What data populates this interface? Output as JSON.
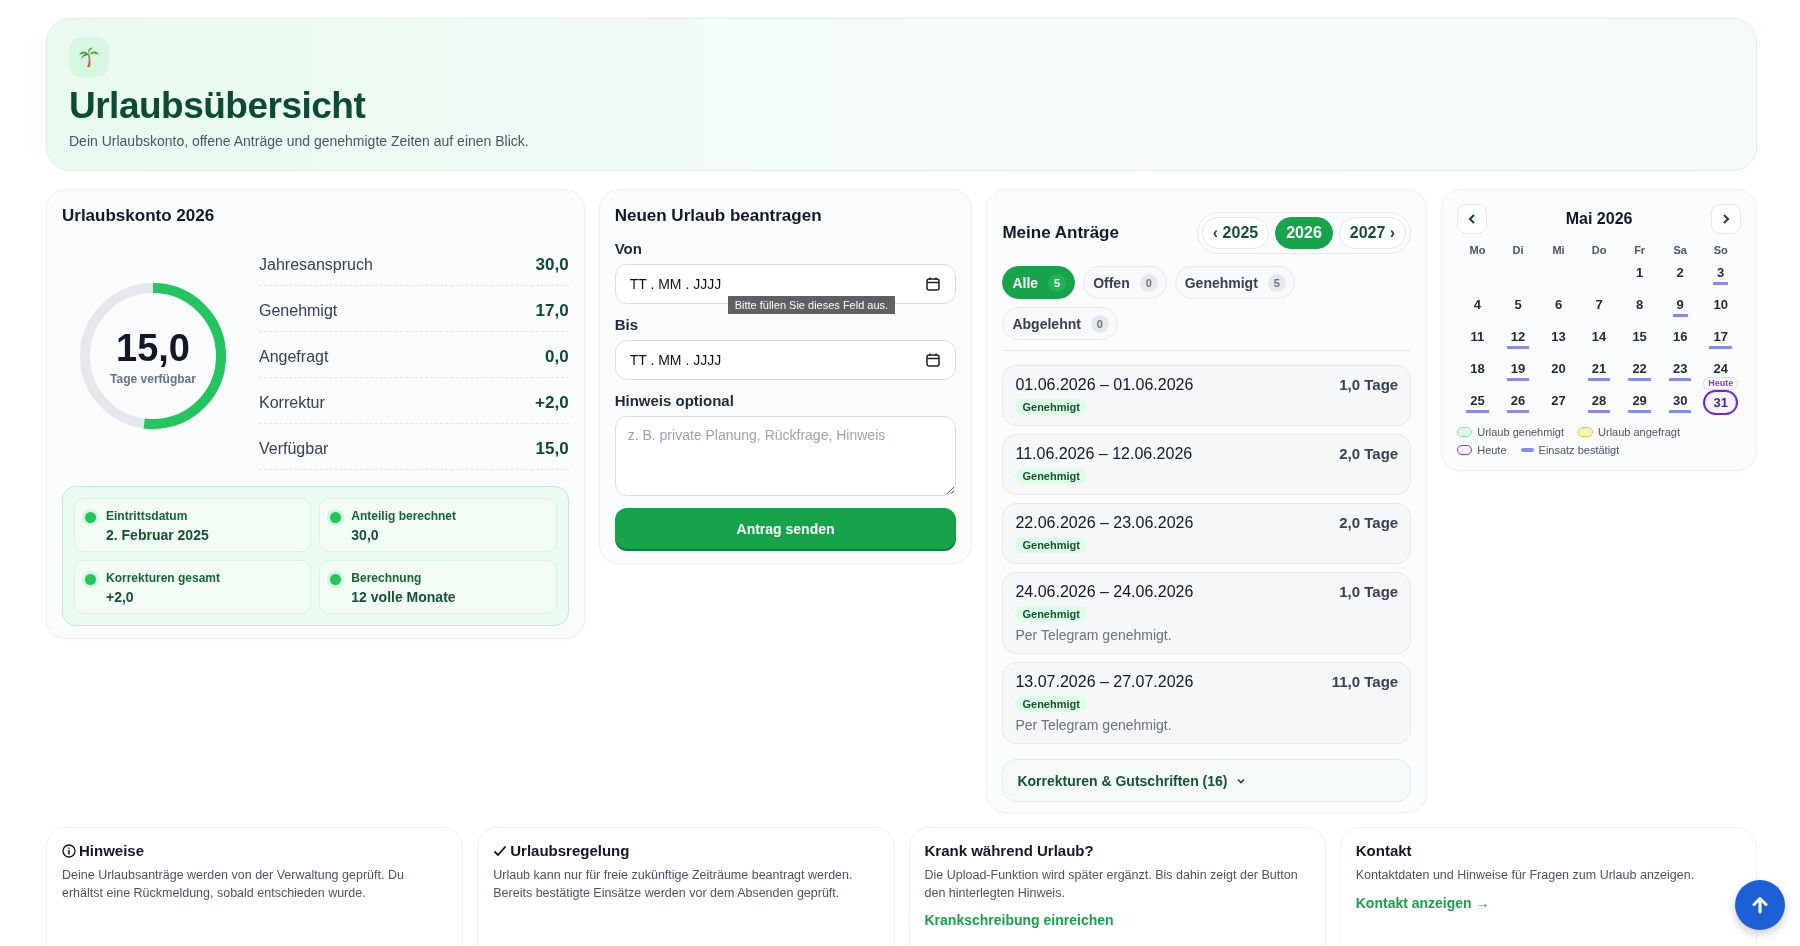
{
  "header": {
    "title": "Urlaubsübersicht",
    "subtitle": "Dein Urlaubskonto, offene Anträge und genehmigte Zeiten auf einen Blick."
  },
  "account": {
    "title": "Urlaubskonto 2026",
    "ring": {
      "value": "15,0",
      "label": "Tage verfügbar",
      "level": 0.52
    },
    "stats": [
      {
        "label": "Jahresanspruch",
        "value": "30,0"
      },
      {
        "label": "Genehmigt",
        "value": "17,0"
      },
      {
        "label": "Angefragt",
        "value": "0,0"
      },
      {
        "label": "Korrektur",
        "value": "+2,0"
      },
      {
        "label": "Verfügbar",
        "value": "15,0"
      }
    ],
    "info": [
      {
        "label": "Eintrittsdatum",
        "value": "2. Februar 2025"
      },
      {
        "label": "Anteilig berechnet",
        "value": "30,0"
      },
      {
        "label": "Korrekturen gesamt",
        "value": "+2,0"
      },
      {
        "label": "Berechnung",
        "value": "12 volle Monate"
      }
    ]
  },
  "form": {
    "title": "Neuen Urlaub beantragen",
    "from": {
      "label": "Von",
      "value": "TT . MM . JJJJ"
    },
    "tooltip": "Bitte füllen Sie dieses Feld aus.",
    "to": {
      "label": "Bis",
      "value": "TT . MM . JJJJ"
    },
    "note": {
      "label": "Hinweis optional",
      "placeholder": "z. B. private Planung, Rückfrage, Hinweis"
    },
    "submit": "Antrag senden"
  },
  "requests": {
    "title": "Meine Anträge",
    "years": [
      {
        "label": "‹ 2025",
        "selected": false
      },
      {
        "label": "2026",
        "selected": true
      },
      {
        "label": "2027 ›",
        "selected": false
      }
    ],
    "filters": [
      {
        "label": "Alle",
        "count": "5",
        "selected": true
      },
      {
        "label": "Offen",
        "count": "0",
        "selected": false
      },
      {
        "label": "Genehmigt",
        "count": "5",
        "selected": false
      },
      {
        "label": "Abgelehnt",
        "count": "0",
        "selected": false
      }
    ],
    "items": [
      {
        "range": "01.06.2026 – 01.06.2026",
        "days": "1,0 Tage",
        "status": "Genehmigt"
      },
      {
        "range": "11.06.2026 – 12.06.2026",
        "days": "2,0 Tage",
        "status": "Genehmigt"
      },
      {
        "range": "22.06.2026 – 23.06.2026",
        "days": "2,0 Tage",
        "status": "Genehmigt"
      },
      {
        "range": "24.06.2026 – 24.06.2026",
        "days": "1,0 Tage",
        "status": "Genehmigt",
        "note": "Per Telegram genehmigt."
      },
      {
        "range": "13.07.2026 – 27.07.2026",
        "days": "11,0 Tage",
        "status": "Genehmigt",
        "note": "Per Telegram genehmigt."
      }
    ],
    "corrections": "Korrekturen & Gutschriften (16)"
  },
  "calendar": {
    "month": "Mai 2026",
    "weekdays": [
      "Mo",
      "Di",
      "Mi",
      "Do",
      "Fr",
      "Sa",
      "So"
    ],
    "weeks": [
      [
        {
          "day": "1",
          "confirmed": false,
          "today": false
        },
        {
          "day": "2",
          "confirmed": false,
          "today": false
        },
        {
          "day": "3",
          "confirmed": true,
          "today": false
        }
      ],
      [
        {
          "day": "4",
          "confirmed": false,
          "today": false
        },
        {
          "day": "5",
          "confirmed": false,
          "today": false
        },
        {
          "day": "6",
          "confirmed": false,
          "today": false
        },
        {
          "day": "7",
          "confirmed": false,
          "today": false
        },
        {
          "day": "8",
          "confirmed": false,
          "today": false
        },
        {
          "day": "9",
          "confirmed": true,
          "today": false
        },
        {
          "day": "10",
          "confirmed": false,
          "today": false
        }
      ],
      [
        {
          "day": "11",
          "confirmed": false,
          "today": false
        },
        {
          "day": "12",
          "confirmed": true,
          "today": false
        },
        {
          "day": "13",
          "confirmed": false,
          "today": false
        },
        {
          "day": "14",
          "confirmed": false,
          "today": false
        },
        {
          "day": "15",
          "confirmed": false,
          "today": false
        },
        {
          "day": "16",
          "confirmed": false,
          "today": false
        },
        {
          "day": "17",
          "confirmed": true,
          "today": false
        }
      ],
      [
        {
          "day": "18",
          "confirmed": false,
          "today": false
        },
        {
          "day": "19",
          "confirmed": true,
          "today": false
        },
        {
          "day": "20",
          "confirmed": false,
          "today": false
        },
        {
          "day": "21",
          "confirmed": true,
          "today": false
        },
        {
          "day": "22",
          "confirmed": true,
          "today": false
        },
        {
          "day": "23",
          "confirmed": true,
          "today": false
        },
        {
          "day": "24",
          "today": false
        }
      ],
      [
        {
          "day": "25",
          "confirmed": true,
          "today": false
        },
        {
          "day": "26",
          "confirmed": true,
          "today": false
        },
        {
          "day": "27",
          "confirmed": false,
          "today": false
        },
        {
          "day": "28",
          "confirmed": true,
          "today": false
        },
        {
          "day": "29",
          "confirmed": true,
          "today": false
        },
        {
          "day": "30",
          "confirmed": true,
          "today": false
        },
        {
          "day": "31",
          "confirmed": false,
          "today": true,
          "badge": "Heute"
        }
      ]
    ],
    "legend": [
      {
        "kind": "approved",
        "label": "Urlaub genehmigt"
      },
      {
        "kind": "requested",
        "label": "Urlaub angefragt"
      },
      {
        "kind": "today",
        "label": "Heute"
      },
      {
        "kind": "confirmed",
        "label": "Einsatz bestätigt"
      }
    ]
  },
  "notes": [
    {
      "kind": "info",
      "title": "Hinweise",
      "text": "Deine Urlaubsanträge werden von der Verwaltung geprüft. Du erhältst eine Rückmeldung, sobald entschieden wurde."
    },
    {
      "kind": "check",
      "title": "Urlaubsregelung",
      "text": "Urlaub kann nur für freie zukünftige Zeiträume beantragt werden. Bereits bestätigte Einsätze werden vor dem Absenden geprüft."
    },
    {
      "kind": "plain",
      "title": "Krank während Urlaub?",
      "text": "Die Upload-Funktion wird später ergänzt. Bis dahin zeigt der Button den hinterlegten Hinweis.",
      "link": "Krankschreibung einreichen"
    },
    {
      "kind": "plain",
      "title": "Kontakt",
      "text": "Kontaktdaten und Hinweise für Fragen zum Urlaub anzeigen.",
      "link": "Kontakt anzeigen →"
    }
  ]
}
